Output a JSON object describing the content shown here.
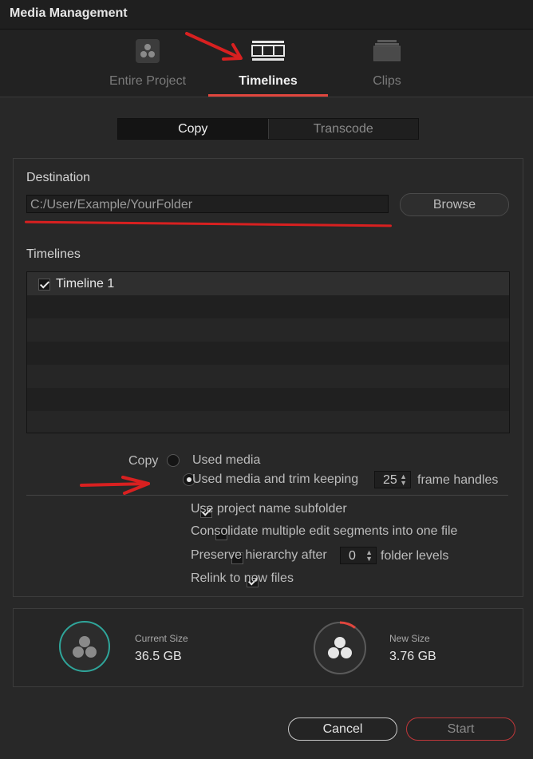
{
  "window": {
    "title": "Media Management"
  },
  "tabs": [
    {
      "label": "Entire Project",
      "icon": "resolve-logo-icon",
      "active": false
    },
    {
      "label": "Timelines",
      "icon": "timeline-icon",
      "active": true
    },
    {
      "label": "Clips",
      "icon": "clips-icon",
      "active": false
    }
  ],
  "mode": {
    "copy_label": "Copy",
    "transcode_label": "Transcode",
    "selected": "Copy"
  },
  "destination": {
    "label": "Destination",
    "path": "C:/User/Example/YourFolder",
    "browse_label": "Browse"
  },
  "timelines": {
    "label": "Timelines",
    "items": [
      {
        "name": "Timeline 1",
        "checked": true
      }
    ]
  },
  "copy_options": {
    "label": "Copy",
    "used_media": "Used media",
    "used_media_trim": "Used media and trim keeping",
    "frame_handles_value": "25",
    "frame_handles_suffix": "frame handles",
    "selected": "used_media_trim"
  },
  "checkboxes": {
    "use_project_name": {
      "label": "Use project name subfolder",
      "checked": true
    },
    "consolidate": {
      "label": "Consolidate multiple edit segments into one file",
      "checked": false
    },
    "preserve_prefix": "Preserve hierarchy after",
    "preserve_value": "0",
    "preserve_suffix": "folder levels",
    "preserve_checked": false,
    "relink": {
      "label": "Relink to new files",
      "checked": true
    }
  },
  "sizes": {
    "current_label": "Current Size",
    "current_value": "36.5 GB",
    "new_label": "New Size",
    "new_value": "3.76 GB"
  },
  "buttons": {
    "cancel": "Cancel",
    "start": "Start"
  },
  "colors": {
    "accent": "#e0463e",
    "teal": "#2fa59a",
    "annotation_red": "#d82020"
  }
}
